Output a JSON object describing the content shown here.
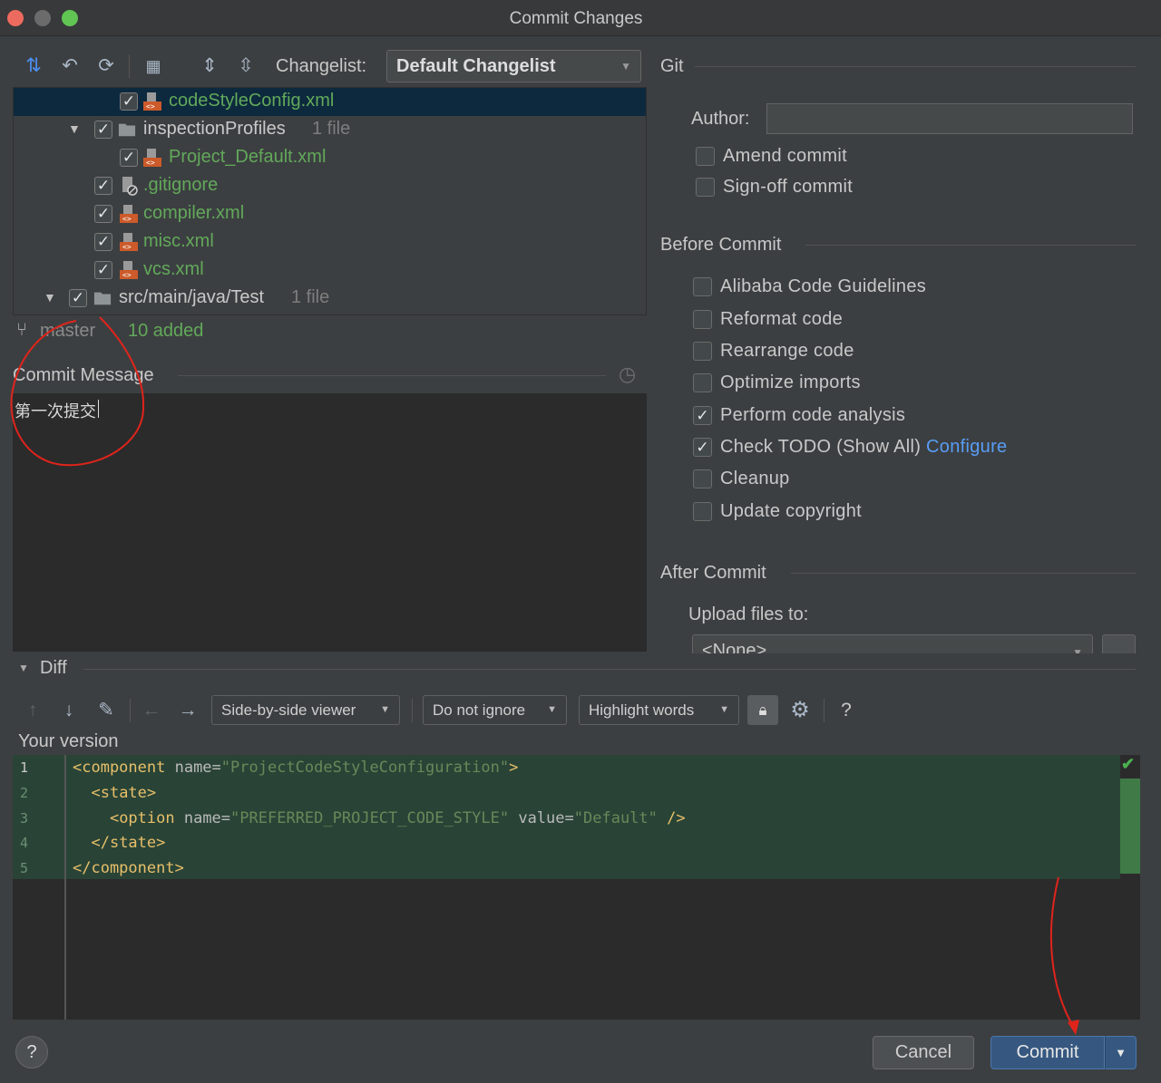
{
  "window": {
    "title": "Commit Changes"
  },
  "toolbar": {
    "changelist_label": "Changelist:",
    "changelist_value": "Default Changelist"
  },
  "tree": {
    "rows": [
      {
        "name": "codeStyleConfig.xml",
        "count": ""
      },
      {
        "name": "inspectionProfiles",
        "count": "1 file"
      },
      {
        "name": "Project_Default.xml",
        "count": ""
      },
      {
        "name": ".gitignore",
        "count": ""
      },
      {
        "name": "compiler.xml",
        "count": ""
      },
      {
        "name": "misc.xml",
        "count": ""
      },
      {
        "name": "vcs.xml",
        "count": ""
      },
      {
        "name": "src/main/java/Test",
        "count": "1 file"
      }
    ]
  },
  "status": {
    "branch": "master",
    "added": "10 added"
  },
  "commit_message": {
    "label": "Commit Message",
    "text": "第一次提交"
  },
  "git": {
    "section": "Git",
    "author_label": "Author:",
    "author_value": "",
    "amend": "Amend commit",
    "signoff": "Sign-off commit"
  },
  "before_commit": {
    "section": "Before Commit",
    "options": [
      {
        "label": "Alibaba Code Guidelines",
        "checked": false
      },
      {
        "label": "Reformat code",
        "checked": false
      },
      {
        "label": "Rearrange code",
        "checked": false
      },
      {
        "label": "Optimize imports",
        "checked": false
      },
      {
        "label": "Perform code analysis",
        "checked": true
      },
      {
        "label": "Check TODO (Show All)",
        "checked": true
      },
      {
        "label": "Cleanup",
        "checked": false
      },
      {
        "label": "Update copyright",
        "checked": false
      }
    ],
    "configure_link": "Configure"
  },
  "after_commit": {
    "section": "After Commit",
    "upload_label": "Upload files to:",
    "upload_value": "<None>"
  },
  "diff": {
    "section": "Diff",
    "viewer": "Side-by-side viewer",
    "ignore": "Do not ignore",
    "highlight": "Highlight words",
    "help": "?",
    "version_label": "Your version",
    "line_numbers": [
      "1",
      "2",
      "3",
      "4",
      "5"
    ],
    "lines": [
      {
        "indent": "",
        "open": "<component",
        "attr1": " name",
        "eq1": "=",
        "val1": "\"ProjectCodeStyleConfiguration\"",
        "attr2": "",
        "eq2": "",
        "val2": "",
        "close": ">"
      },
      {
        "indent": "  ",
        "open": "<state",
        "attr1": "",
        "eq1": "",
        "val1": "",
        "attr2": "",
        "eq2": "",
        "val2": "",
        "close": ">"
      },
      {
        "indent": "    ",
        "open": "<option",
        "attr1": " name",
        "eq1": "=",
        "val1": "\"PREFERRED_PROJECT_CODE_STYLE\"",
        "attr2": " value",
        "eq2": "=",
        "val2": "\"Default\"",
        "close": " />"
      },
      {
        "indent": "  ",
        "open": "</state",
        "attr1": "",
        "eq1": "",
        "val1": "",
        "attr2": "",
        "eq2": "",
        "val2": "",
        "close": ">"
      },
      {
        "indent": "",
        "open": "</component",
        "attr1": "",
        "eq1": "",
        "val1": "",
        "attr2": "",
        "eq2": "",
        "val2": "",
        "close": ">"
      }
    ]
  },
  "footer": {
    "help": "?",
    "cancel": "Cancel",
    "commit": "Commit"
  },
  "colors": {
    "accent": "#365880",
    "added_bg": "#294436",
    "green_text": "#62a95a",
    "annotation_red": "#e0241b"
  }
}
